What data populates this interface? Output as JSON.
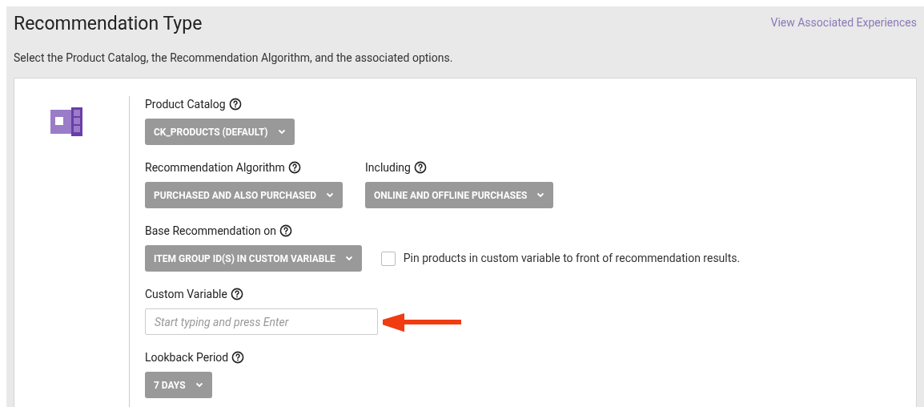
{
  "header": {
    "title": "Recommendation Type",
    "link": "View Associated Experiences",
    "description": "Select the Product Catalog, the Recommendation Algorithm, and the associated options."
  },
  "rows": [
    {
      "items": [
        {
          "kind": "dropdown",
          "label": "Product Catalog",
          "value": "CK_PRODUCTS (DEFAULT)"
        }
      ]
    },
    {
      "items": [
        {
          "kind": "dropdown",
          "label": "Recommendation Algorithm",
          "value": "PURCHASED AND ALSO PURCHASED"
        },
        {
          "kind": "dropdown",
          "label": "Including",
          "value": "ONLINE AND OFFLINE PURCHASES"
        }
      ]
    },
    {
      "items": [
        {
          "kind": "dropdown",
          "label": "Base Recommendation on",
          "value": "ITEM GROUP ID(S) IN CUSTOM VARIABLE"
        },
        {
          "kind": "checkbox",
          "text": "Pin products in custom variable to front of recommendation results.",
          "checked": false
        }
      ]
    },
    {
      "items": [
        {
          "kind": "input",
          "label": "Custom Variable",
          "placeholder": "Start typing and press Enter",
          "pointer": true
        }
      ]
    },
    {
      "items": [
        {
          "kind": "dropdown",
          "label": "Lookback Period",
          "value": "7 DAYS"
        }
      ]
    }
  ]
}
